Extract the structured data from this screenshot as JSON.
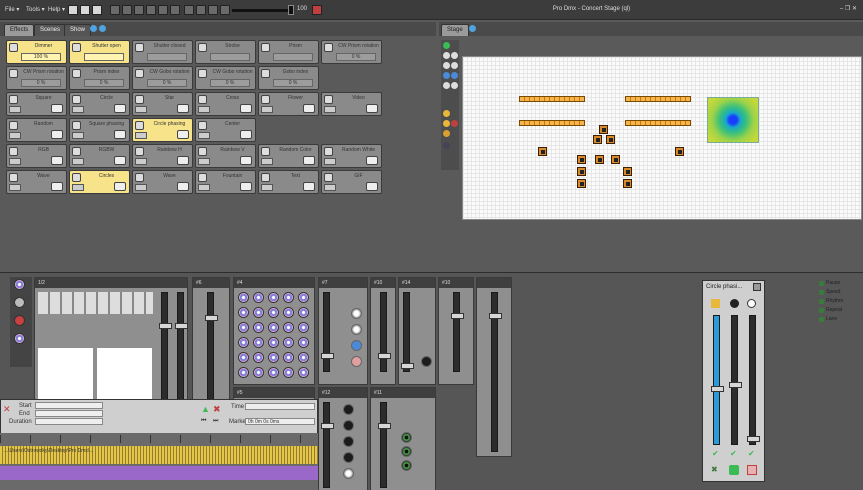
{
  "menubar": {
    "file": "File ▾",
    "tools": "Tools ▾",
    "help": "Help ▾",
    "volume_value": "100",
    "window_title": "Pro Dmx - Concert Stage (ql)",
    "window_controls": "– ❐ ✕"
  },
  "left_tabs": [
    "Effects",
    "Scenes",
    "Show"
  ],
  "stage_tab": "Stage",
  "effects": [
    {
      "label": "Dimmer",
      "value": "100 %",
      "on": true
    },
    {
      "label": "Shutter open",
      "value": "",
      "on": true
    },
    {
      "label": "Shutter closed",
      "value": "",
      "on": false
    },
    {
      "label": "Strobe",
      "value": "",
      "on": false
    },
    {
      "label": "Prism",
      "value": "",
      "on": false
    },
    {
      "label": "CW Prism rotation",
      "value": "0 %",
      "on": false
    },
    {
      "label": "CW Prism rotation",
      "value": "0 %",
      "on": false
    },
    {
      "label": "Prism index",
      "value": "0 %",
      "on": false
    },
    {
      "label": "CW Gobo rotation",
      "value": "0 %",
      "on": false
    },
    {
      "label": "CW Gobo rotation",
      "value": "0 %",
      "on": false
    },
    {
      "label": "Gobo index",
      "value": "0 %",
      "on": false
    },
    {
      "label": "Square",
      "value": "",
      "on": false
    },
    {
      "label": "Circle",
      "value": "",
      "on": false
    },
    {
      "label": "Star",
      "value": "",
      "on": false
    },
    {
      "label": "Cross",
      "value": "",
      "on": false
    },
    {
      "label": "Flower",
      "value": "",
      "on": false
    },
    {
      "label": "Video",
      "value": "",
      "on": false
    },
    {
      "label": "Random",
      "value": "",
      "on": false
    },
    {
      "label": "Square phasing",
      "value": "",
      "on": false
    },
    {
      "label": "Circle phasing",
      "value": "",
      "on": true
    },
    {
      "label": "Center",
      "value": "",
      "on": false
    },
    {
      "label": "RGB",
      "value": "",
      "on": false
    },
    {
      "label": "RGBW",
      "value": "",
      "on": false
    },
    {
      "label": "Rainbow H",
      "value": "",
      "on": false
    },
    {
      "label": "Rainbow V",
      "value": "",
      "on": false
    },
    {
      "label": "Random Color",
      "value": "",
      "on": false
    },
    {
      "label": "Random White",
      "value": "",
      "on": false
    },
    {
      "label": "Wave",
      "value": "",
      "on": false
    },
    {
      "label": "Circles",
      "value": "",
      "on": true
    },
    {
      "label": "Wave",
      "value": "",
      "on": false
    },
    {
      "label": "Fountain",
      "value": "",
      "on": false
    },
    {
      "label": "Text",
      "value": "",
      "on": false
    },
    {
      "label": "GIF",
      "value": "",
      "on": false
    }
  ],
  "panels": {
    "p1": "1/2",
    "p2": "#6",
    "p3": "#4",
    "p4": "#7",
    "p5": "#10",
    "p6": "#14",
    "p7": "#10",
    "p8": "#5",
    "p9": "#12",
    "p10": "#11"
  },
  "show_manager": {
    "start_label": "Start",
    "end_label": "End",
    "duration_label": "Duration",
    "time_label": "Time",
    "marker_label": "Marker",
    "marker_value": "0h 0m 0s 0ms",
    "file_path": "...\\Users\\Ostrowsky\\Desktop\\Pro Dmx\\..."
  },
  "circle_panel": {
    "title": "Circle phasi..."
  },
  "right_list": [
    "Pause",
    "Speed",
    "Rhythm",
    "Repeat",
    "Lane"
  ],
  "colors": {
    "accent_active": "#f6e38a",
    "background": "#5a5a5a",
    "stage_fixture": "#d98a2a"
  }
}
